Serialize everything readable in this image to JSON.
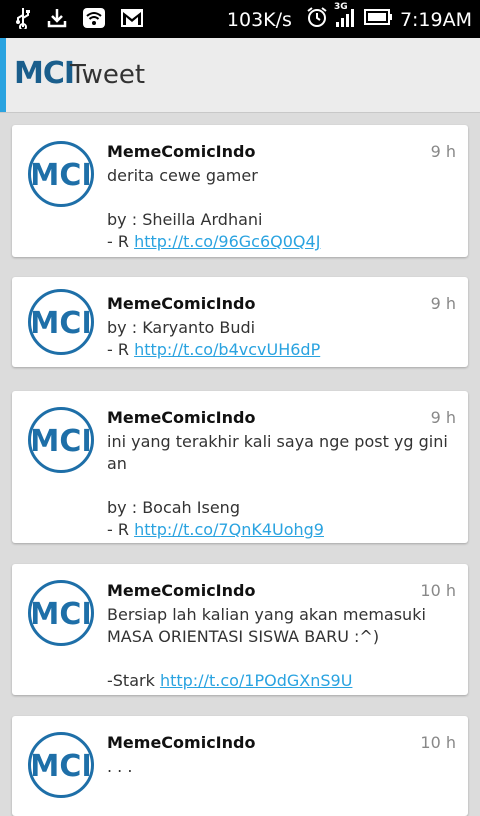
{
  "status_bar": {
    "network_speed": "103K/s",
    "network_type": "3G",
    "time": "7:19AM",
    "icons": [
      "usb-icon",
      "download-icon",
      "wifi-icon",
      "gmail-icon",
      "alarm-icon",
      "signal-icon",
      "battery-icon"
    ]
  },
  "app_bar": {
    "logo_text": "MCI",
    "title": "Tweet",
    "accent_color": "#2aa3e0",
    "logo_color": "#1a5e8c"
  },
  "tweets": [
    {
      "author": "MemeComicIndo",
      "time": "9 h",
      "avatar_text": "MCI",
      "body": "derita cewe gamer\n\nby : Sheilla Ardhani\n- R ",
      "link": "http://t.co/96Gc6Q0Q4J"
    },
    {
      "author": "MemeComicIndo",
      "time": "9 h",
      "avatar_text": "MCI",
      "body": "by : Karyanto Budi\n- R ",
      "link": "http://t.co/b4vcvUH6dP"
    },
    {
      "author": "MemeComicIndo",
      "time": "9 h",
      "avatar_text": "MCI",
      "body": "ini yang terakhir kali saya nge post yg gini\nan\n\nby : Bocah Iseng\n- R ",
      "link": "http://t.co/7QnK4Uohg9"
    },
    {
      "author": "MemeComicIndo",
      "time": "10 h",
      "avatar_text": "MCI",
      "body": "Bersiap lah kalian yang akan memasuki\nMASA ORIENTASI SISWA BARU :^)\n\n-Stark ",
      "link": "http://t.co/1POdGXnS9U"
    },
    {
      "author": "MemeComicIndo",
      "time": "10 h",
      "avatar_text": "MCI",
      "body": ". . .",
      "link": ""
    }
  ],
  "colors": {
    "link": "#2aa3e0",
    "avatar_border": "#1e6fa8",
    "background": "#dcdcdc"
  }
}
